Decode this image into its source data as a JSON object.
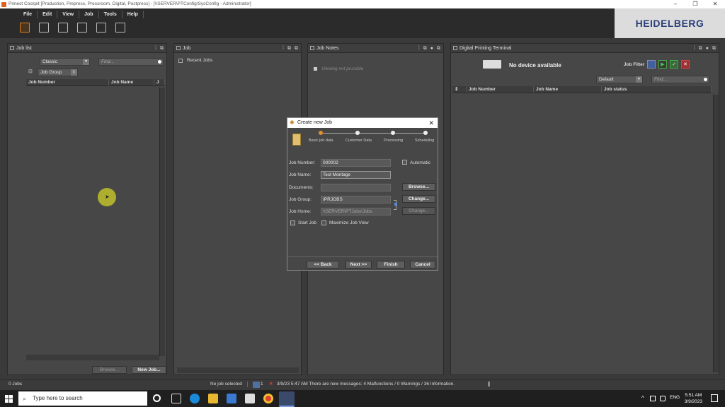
{
  "window": {
    "title": "Prinect Cockpit [Production, Prepress, Pressroom, Digital, Postpress] - [\\\\SERVER\\PTConfig\\SysConfig - Administrator]",
    "controls": [
      "–",
      "❐",
      "✕"
    ]
  },
  "menu": [
    "File",
    "Edit",
    "View",
    "Job",
    "Tools",
    "Help"
  ],
  "logo": "HEIDELBERG",
  "joblist": {
    "title": "Job list",
    "view_combo": "Classic",
    "find_placeholder": "Find...",
    "group_combo": "Job Group",
    "columns": [
      "Job Number",
      "Job Name",
      "J"
    ],
    "browse_button": "Browse...",
    "new_job_button": "New Job..."
  },
  "job": {
    "title": "Job",
    "recent": "Recent Jobs"
  },
  "notes": {
    "title": "Job Notes",
    "empty": "Viewing not possible"
  },
  "dpt": {
    "title": "Digital Printing Terminal",
    "no_device": "No device available",
    "job_filter": "Job Filter",
    "filter_combo": "Default",
    "find_placeholder": "Find...",
    "columns": [
      "Job Number",
      "Job Name",
      "Job status"
    ]
  },
  "dialog": {
    "title": "Create new Job",
    "steps": [
      "Basic job data",
      "Customer Data",
      "Processing",
      "Scheduling"
    ],
    "job_number_label": "Job Number:",
    "job_number": "000002",
    "automatic_label": "Automatic",
    "job_name_label": "Job Name:",
    "job_name": "Test Montage",
    "documents_label": "Documents:",
    "documents": "",
    "browse_button": "Browse...",
    "job_group_label": "Job Group:",
    "job_group": "/PRJOBS",
    "change_button": "Change...",
    "job_home_label": "Job Home:",
    "job_home": "\\\\SERVER\\PTJobs\\Jobs",
    "change_home_button": "Change...",
    "start_job_label": "Start Job",
    "maximize_label": "Maximize Job View",
    "back_button": "<< Back",
    "next_button": "Next >>",
    "finish_button": "Finish",
    "cancel_button": "Cancel"
  },
  "status": {
    "jobs": "0 Jobs",
    "selected": "No job selected",
    "counter": "1",
    "message": "3/9/23 5:47 AM  There are new messages: 4 Malfunctions / 0 Warnings / 36 Information."
  },
  "taskbar": {
    "search_placeholder": "Type here to search",
    "lang": "ENG",
    "time": "5:51 AM",
    "date": "3/9/2023"
  }
}
